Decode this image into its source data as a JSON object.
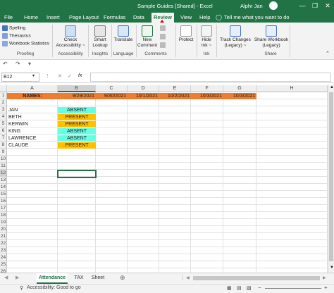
{
  "titlebar": {
    "doc_title": "Sample Guides  [Shared]  -  Excel",
    "user_name": "Alphr Jan",
    "minimize": "—",
    "restore": "❐",
    "close": "✕"
  },
  "tabs": [
    "File",
    "Home",
    "Insert",
    "Page Layout",
    "Formulas",
    "Data",
    "Review",
    "View",
    "Help"
  ],
  "tell_me": "Tell me what you want to do",
  "ribbon": {
    "proofing": {
      "label": "Proofing",
      "spelling": "Spelling",
      "thesaurus": "Thesaurus",
      "workbook_statistics": "Workbook Statistics"
    },
    "accessibility": {
      "label": "Accessibility",
      "check_line1": "Check",
      "check_line2": "Accessibility ~"
    },
    "insights": {
      "label": "Insights",
      "smart_line1": "Smart",
      "smart_line2": "Lookup"
    },
    "language": {
      "label": "Language",
      "translate": "Translate"
    },
    "comments": {
      "label": "Comments",
      "new_line1": "New",
      "new_line2": "Comment"
    },
    "protect": {
      "label": "",
      "protect": "Protect"
    },
    "ink": {
      "label": "Ink",
      "hide_line1": "Hide",
      "hide_line2": "Ink ~"
    },
    "changes": {
      "track_line1": "Track Changes",
      "track_line2": "(Legacy) ~"
    },
    "share": {
      "label": "Share",
      "share_line1": "Share Workbook",
      "share_line2": "(Legacy)"
    }
  },
  "formula_bar": {
    "name_box": "B12",
    "fx": "fx",
    "value": ""
  },
  "columns": [
    "A",
    "B",
    "C",
    "D",
    "E",
    "F",
    "G",
    "H"
  ],
  "rows": [
    "1",
    "2",
    "3",
    "4",
    "5",
    "6",
    "7",
    "8",
    "9",
    "10",
    "11",
    "12",
    "13",
    "14",
    "15",
    "16",
    "17",
    "18",
    "19",
    "20",
    "21",
    "22",
    "23",
    "24",
    "25",
    "26"
  ],
  "sheet": {
    "header_label": "NAMES:",
    "dates": [
      "9/29/2021",
      "9/30/2021",
      "10/1/2021",
      "10/2/2021",
      "10/3/2021",
      "10/3/2021"
    ],
    "names": [
      "JAN",
      "BETH",
      "KERWIN",
      "KING",
      "LAWRENCE",
      "CLAUDE"
    ],
    "statuses": [
      "ABSENT",
      "PRESENT",
      "PRESENT",
      "ABSENT",
      "ABSENT",
      "PRESENT"
    ]
  },
  "sheet_tabs": [
    "Attendance",
    "TAX",
    "Sheet"
  ],
  "status_bar": {
    "accessibility": "Accessibility: Good to go"
  },
  "colors": {
    "excel_green": "#217346",
    "header_orange": "#ed7d31",
    "absent_cyan": "#66ffe6",
    "present_amber": "#ffc000"
  }
}
